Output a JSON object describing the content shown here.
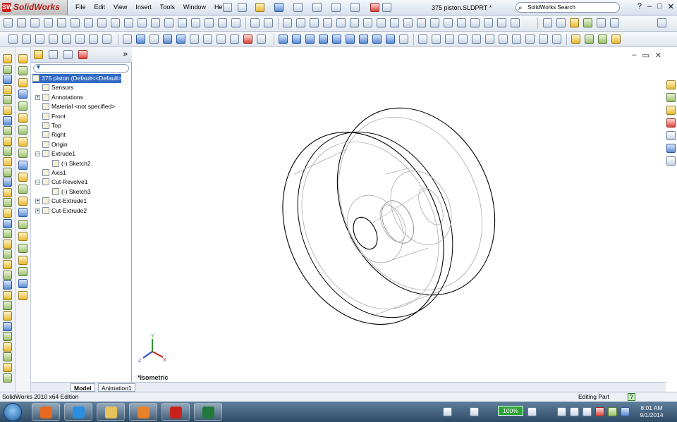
{
  "app": {
    "name": "SolidWorks",
    "logo_letters": "SW"
  },
  "menu": [
    "File",
    "Edit",
    "View",
    "Insert",
    "Tools",
    "Window",
    "Help"
  ],
  "document": {
    "title": "375 piston.SLDPRT *"
  },
  "search": {
    "value": "SolidWorks Search"
  },
  "window_controls": {
    "help": "?",
    "minimize": "–",
    "restore": "□",
    "close": "✕"
  },
  "graphics_controls": {
    "minimize": "–",
    "restore": "▭",
    "close": "✕"
  },
  "feature_tree": {
    "expand_arrow": "»",
    "items": [
      {
        "label": "375 piston  (Default<<Default>",
        "icon": "part-icon",
        "selected": true,
        "indent": 0
      },
      {
        "label": "Sensors",
        "icon": "sensors-icon",
        "indent": 1
      },
      {
        "label": "Annotations",
        "icon": "annotations-icon",
        "indent": 1,
        "expander": "+"
      },
      {
        "label": "Material <not specified>",
        "icon": "material-icon",
        "indent": 1
      },
      {
        "label": "Front",
        "icon": "plane-icon",
        "indent": 1
      },
      {
        "label": "Top",
        "icon": "plane-icon",
        "indent": 1
      },
      {
        "label": "Right",
        "icon": "plane-icon",
        "indent": 1
      },
      {
        "label": "Origin",
        "icon": "origin-icon",
        "indent": 1
      },
      {
        "label": "Extrude1",
        "icon": "extrude-icon",
        "indent": 1,
        "expander": "–"
      },
      {
        "label": "(-) Sketch2",
        "icon": "sketch-icon",
        "indent": 2
      },
      {
        "label": "Axis1",
        "icon": "axis-icon",
        "indent": 1
      },
      {
        "label": "Cut-Revolve1",
        "icon": "revolve-cut-icon",
        "indent": 1,
        "expander": "–"
      },
      {
        "label": "(-) Sketch3",
        "icon": "sketch-icon",
        "indent": 2
      },
      {
        "label": "Cut-Extrude1",
        "icon": "cut-extrude-icon",
        "indent": 1,
        "expander": "+"
      },
      {
        "label": "Cut-Extrude2",
        "icon": "cut-extrude-icon",
        "indent": 1,
        "expander": "+"
      }
    ]
  },
  "view": {
    "label": "*Isometric"
  },
  "triad": {
    "x": "X",
    "y": "Y",
    "z": "Z"
  },
  "bottom_tabs": [
    {
      "label": "Model",
      "active": true
    },
    {
      "label": "Animation1",
      "active": false
    }
  ],
  "status": {
    "left": "SolidWorks 2010 x64 Edition",
    "right": "Editing Part",
    "help": "?"
  },
  "taskbar": {
    "battery": "100%",
    "clock_time": "8:01 AM",
    "clock_date": "9/1/2014",
    "apps": [
      {
        "name": "firefox-icon",
        "color": "#e66a1f"
      },
      {
        "name": "internet-explorer-icon",
        "color": "#2b8fe0"
      },
      {
        "name": "file-explorer-icon",
        "color": "#e7c35c"
      },
      {
        "name": "media-player-icon",
        "color": "#e8812b"
      },
      {
        "name": "solidworks-icon",
        "color": "#c8211b"
      },
      {
        "name": "excel-icon",
        "color": "#1f7a3a"
      }
    ]
  },
  "colors": {
    "selection": "#316ac5",
    "accent": "#c8211b"
  }
}
